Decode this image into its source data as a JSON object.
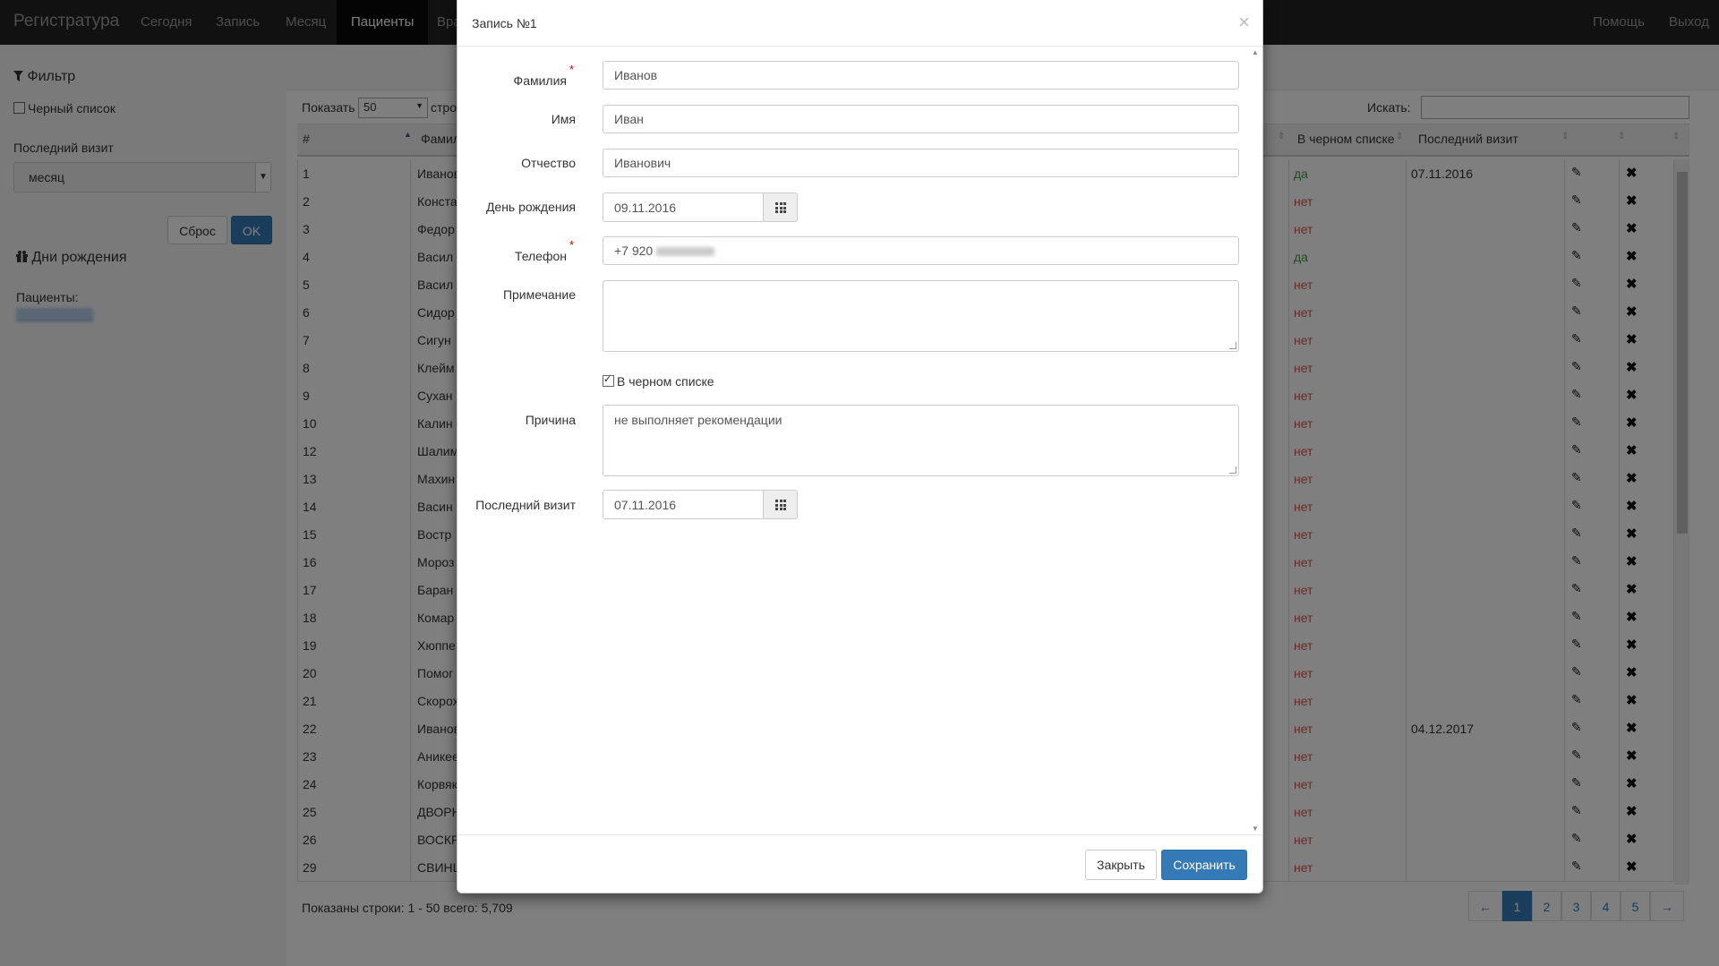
{
  "navbar": {
    "brand": "Регистратура",
    "items": [
      {
        "label": "Сегодня"
      },
      {
        "label": "Запись"
      },
      {
        "label": "Месяц"
      },
      {
        "label": "Пациенты"
      },
      {
        "label": "Вра"
      }
    ],
    "right": [
      {
        "label": "Помощь"
      },
      {
        "label": "Выход"
      }
    ]
  },
  "sidebar": {
    "filter_title": "Фильтр",
    "blacklist_label": "Черный список",
    "last_visit_label": "Последний визит",
    "period_value": "месяц",
    "reset_label": "Сброс",
    "ok_label": "OK",
    "birthdays_title": "Дни рождения",
    "patients_label": "Пациенты:"
  },
  "table": {
    "show_label": "Показать",
    "page_size": "50",
    "rows_label": "стро",
    "search_label": "Искать:",
    "headers": {
      "num": "#",
      "surname": "Фамил",
      "blacklist": "В черном списке",
      "last_visit": "Последний визит"
    },
    "rows": [
      {
        "num": "1",
        "name": "Иванов",
        "bl": "да",
        "visit": "07.11.2016"
      },
      {
        "num": "2",
        "name": "Конста",
        "bl": "нет",
        "visit": ""
      },
      {
        "num": "3",
        "name": "Федор",
        "bl": "нет",
        "visit": ""
      },
      {
        "num": "4",
        "name": "Васил",
        "bl": "да",
        "visit": ""
      },
      {
        "num": "5",
        "name": "Васил",
        "bl": "нет",
        "visit": ""
      },
      {
        "num": "6",
        "name": "Сидор",
        "bl": "нет",
        "visit": ""
      },
      {
        "num": "7",
        "name": "Сигун",
        "bl": "нет",
        "visit": ""
      },
      {
        "num": "8",
        "name": "Клейм",
        "bl": "нет",
        "visit": ""
      },
      {
        "num": "9",
        "name": "Сухан",
        "bl": "нет",
        "visit": ""
      },
      {
        "num": "10",
        "name": "Калин",
        "bl": "нет",
        "visit": ""
      },
      {
        "num": "12",
        "name": "Шалим",
        "bl": "нет",
        "visit": ""
      },
      {
        "num": "13",
        "name": "Махин",
        "bl": "нет",
        "visit": ""
      },
      {
        "num": "14",
        "name": "Васин",
        "bl": "нет",
        "visit": ""
      },
      {
        "num": "15",
        "name": "Востр",
        "bl": "нет",
        "visit": ""
      },
      {
        "num": "16",
        "name": "Мороз",
        "bl": "нет",
        "visit": ""
      },
      {
        "num": "17",
        "name": "Баран",
        "bl": "нет",
        "visit": ""
      },
      {
        "num": "18",
        "name": "Комар",
        "bl": "нет",
        "visit": ""
      },
      {
        "num": "19",
        "name": "Хюппе",
        "bl": "нет",
        "visit": ""
      },
      {
        "num": "20",
        "name": "Помог",
        "bl": "нет",
        "visit": ""
      },
      {
        "num": "21",
        "name": "Скорох",
        "bl": "нет",
        "visit": ""
      },
      {
        "num": "22",
        "name": "Иванов",
        "bl": "нет",
        "visit": "04.12.2017"
      },
      {
        "num": "23",
        "name": "Аникее",
        "bl": "нет",
        "visit": ""
      },
      {
        "num": "24",
        "name": "Корвяк",
        "bl": "нет",
        "visit": ""
      },
      {
        "num": "25",
        "name": "ДВОРН",
        "bl": "нет",
        "visit": ""
      },
      {
        "num": "26",
        "name": "ВОСКР",
        "bl": "нет",
        "visit": ""
      },
      {
        "num": "29",
        "name": "СВИНЦ",
        "bl": "нет",
        "visit": ""
      }
    ],
    "footer_info": "Показаны строки: 1 - 50 всего: 5,709",
    "pager": [
      "←",
      "1",
      "2",
      "3",
      "4",
      "5",
      "→"
    ]
  },
  "modal": {
    "title": "Запись №1",
    "fields": {
      "surname_label": "Фамилия",
      "surname_value": "Иванов",
      "name_label": "Имя",
      "name_value": "Иван",
      "patronymic_label": "Отчество",
      "patronymic_value": "Иванович",
      "birthday_label": "День рождения",
      "birthday_value": "09.11.2016",
      "phone_label": "Телефон",
      "phone_value": "+7 920",
      "note_label": "Примечание",
      "note_value": "",
      "blacklist_label": "В черном списке",
      "reason_label": "Причина",
      "reason_value": "не выполняет рекомендации",
      "last_visit_label": "Последний визит",
      "last_visit_value": "07.11.2016"
    },
    "close_label": "Закрыть",
    "save_label": "Сохранить"
  },
  "colors": {
    "navbar_bg": "#222222",
    "primary": "#337ab7",
    "yes": "#3c9a3c",
    "no": "#d9534f"
  },
  "icons": [
    "filter-icon",
    "gift-icon",
    "calendar-icon",
    "pencil-icon",
    "remove-icon",
    "close-icon",
    "sort-icon"
  ]
}
